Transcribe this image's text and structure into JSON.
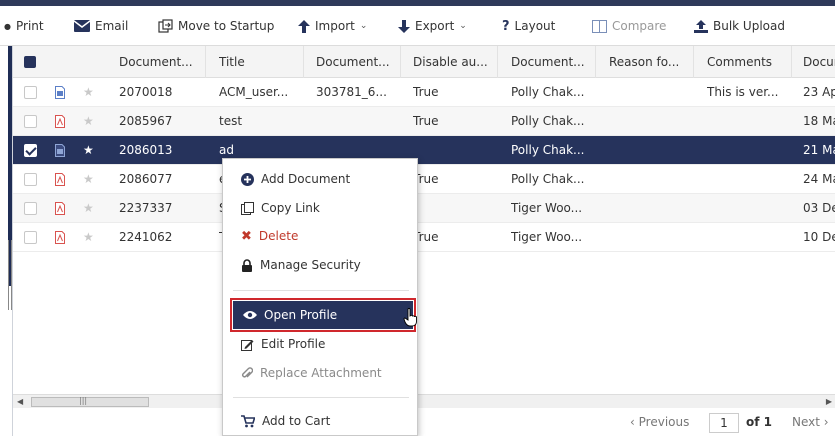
{
  "toolbar": {
    "print": "Print",
    "email": "Email",
    "move_to_startup": "Move to Startup",
    "import": "Import",
    "export": "Export",
    "layout": "Layout",
    "compare": "Compare",
    "bulk_upload": "Bulk Upload"
  },
  "columns": [
    "Document...",
    "Title",
    "Document...",
    "Disable au...",
    "Document...",
    "Reason fo...",
    "Comments",
    "Docur"
  ],
  "rows": [
    {
      "num": "2070018",
      "title": "ACM_user...",
      "doc": "303781_6...",
      "disable": "True",
      "owner": "Polly Chak...",
      "reason": "",
      "comments": "This is ver...",
      "date": "23 Ap",
      "file": "doc",
      "selected": false
    },
    {
      "num": "2085967",
      "title": "test",
      "doc": "",
      "disable": "True",
      "owner": "Polly Chak...",
      "reason": "",
      "comments": "",
      "date": "18 Ma",
      "file": "pdf",
      "selected": false
    },
    {
      "num": "2086013",
      "title": "ad",
      "doc": "",
      "disable": "",
      "owner": "Polly Chak...",
      "reason": "",
      "comments": "",
      "date": "21 Ma",
      "file": "doc",
      "selected": true
    },
    {
      "num": "2086077",
      "title": "et",
      "doc": "",
      "disable": "True",
      "owner": "Polly Chak...",
      "reason": "",
      "comments": "",
      "date": "24 Ma",
      "file": "pdf",
      "selected": false
    },
    {
      "num": "2237337",
      "title": "Sh",
      "doc": "",
      "disable": "",
      "owner": "Tiger Woo...",
      "reason": "",
      "comments": "",
      "date": "03 De",
      "file": "pdf",
      "selected": false
    },
    {
      "num": "2241062",
      "title": "TE",
      "doc": "",
      "disable": "True",
      "owner": "Tiger Woo...",
      "reason": "",
      "comments": "",
      "date": "10 De",
      "file": "pdf",
      "selected": false
    }
  ],
  "context_menu": {
    "add_document": "Add Document",
    "copy_link": "Copy Link",
    "delete": "Delete",
    "manage_security": "Manage Security",
    "open_profile": "Open Profile",
    "edit_profile": "Edit Profile",
    "replace_attachment": "Replace Attachment",
    "add_to_cart": "Add to Cart"
  },
  "pager": {
    "previous": "Previous",
    "page": "1",
    "of": "of 1",
    "next": "Next"
  },
  "colors": {
    "accent": "#26335c",
    "highlight_border": "#d0282d",
    "pdf": "#d9534f",
    "doc": "#5b7fc7"
  }
}
